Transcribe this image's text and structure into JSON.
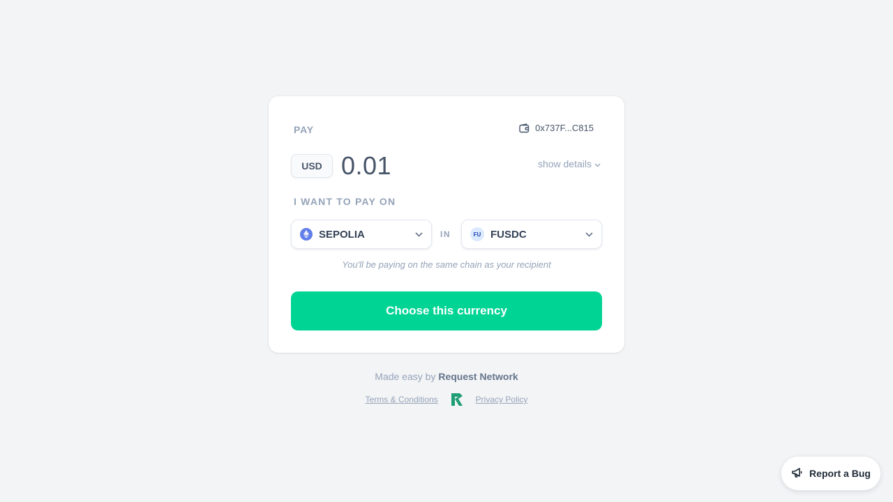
{
  "card": {
    "pay_label": "PAY",
    "wallet_address": "0x737F...C815",
    "currency_code": "USD",
    "amount": "0.01",
    "show_details_label": "show details",
    "want_label": "I WANT TO PAY ON",
    "chain_select": {
      "value": "SEPOLIA",
      "icon": "ethereum-icon"
    },
    "in_label": "IN",
    "token_select": {
      "value": "FUSDC",
      "icon_text": "FU"
    },
    "hint": "You'll be paying on the same chain as your recipient",
    "cta_label": "Choose this currency"
  },
  "footer": {
    "made_easy_prefix": "Made easy by",
    "brand": "Request Network",
    "terms_label": "Terms & Conditions",
    "privacy_label": "Privacy Policy",
    "logo_icon": "request-network-logo"
  },
  "bug_button": {
    "label": "Report a Bug",
    "icon": "megaphone-icon"
  },
  "colors": {
    "accent": "#00d494",
    "background": "#f3f4f6",
    "muted_text": "#94a3b8",
    "brand_logo": "#1f9d74"
  }
}
